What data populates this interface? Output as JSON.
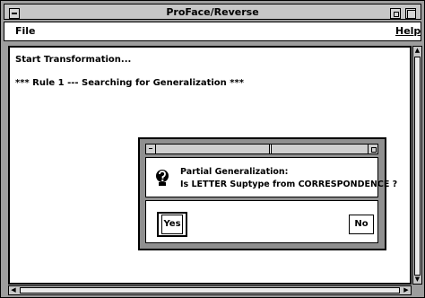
{
  "window": {
    "title": "ProFace/Reverse"
  },
  "menubar": {
    "file": "File",
    "help": "Help"
  },
  "log": {
    "lines": [
      "Start Transformation...",
      "*** Rule 1 --- Searching for Generalization ***"
    ]
  },
  "dialog": {
    "icon": "question-icon",
    "message_lines": [
      "Partial Generalization:",
      "Is LETTER Suptype from CORRESPONDENCE ?"
    ],
    "yes_label": "Yes",
    "no_label": "No"
  },
  "scroll": {
    "up_arrow": "▲",
    "down_arrow": "▼",
    "left_arrow": "◀",
    "right_arrow": "▶"
  }
}
